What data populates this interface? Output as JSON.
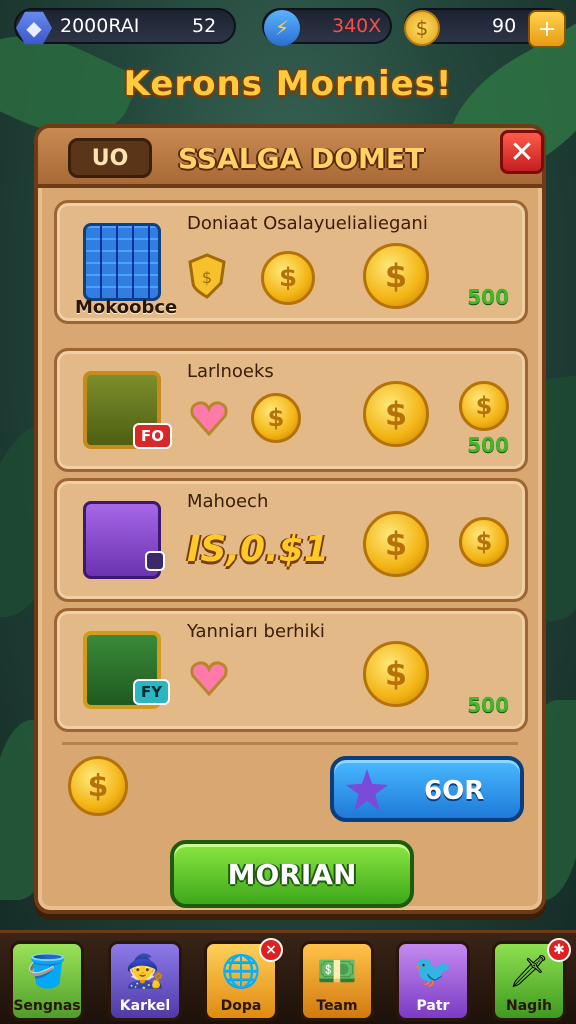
{
  "hud": {
    "gems_value": "2000RAI",
    "gems_sub": "52",
    "bolt_value": "340X",
    "coins_value": "90",
    "plus_label": "+"
  },
  "screen_title": "Kerons Mornies!",
  "panel": {
    "tag": "UO",
    "title": "SSALGA DOMET",
    "close_label": "✕",
    "rows": [
      {
        "title": "Doniaat Osalayuelialiegani",
        "caption": "Mokoobce",
        "amount": "500"
      },
      {
        "title": "Larlnoeks",
        "badge": "FO",
        "amount": "500"
      },
      {
        "title": "Mahoech",
        "price": "IS,0.$1"
      },
      {
        "title": "Yanniarı berhiki",
        "badge": "FY",
        "amount": "500"
      }
    ],
    "blue_button_label": "6OR",
    "green_button_label": "MORIAN"
  },
  "nav": {
    "items": [
      {
        "label": "Sengnas"
      },
      {
        "label": "Karkel"
      },
      {
        "label": "Dopa",
        "badge": "×"
      },
      {
        "label": "Team"
      },
      {
        "label": "Patr"
      },
      {
        "label": "Nagih",
        "badge": "✱"
      }
    ]
  },
  "colors": {
    "panel": "#d9a872",
    "accent_gold": "#ffcb3d",
    "amount_green": "#3fb82a",
    "button_blue": "#2b8ae8",
    "button_green": "#5cc22c",
    "close_red": "#e03030"
  },
  "icons": {
    "gem": "gem-icon",
    "bolt": "bolt-icon",
    "coin": "coin-icon",
    "plus": "plus-icon",
    "close": "close-icon",
    "heart": "heart-icon",
    "shield": "shield-icon",
    "star": "star-icon"
  }
}
